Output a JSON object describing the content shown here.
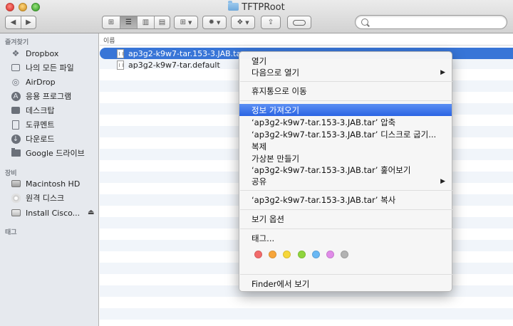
{
  "window": {
    "title": "TFTPRoot"
  },
  "sidebar": {
    "favorites_header": "즐겨찾기",
    "favorites": [
      {
        "label": "Dropbox",
        "icon": "dropbox-icon"
      },
      {
        "label": "나의 모든 파일",
        "icon": "all-files-icon"
      },
      {
        "label": "AirDrop",
        "icon": "airdrop-icon"
      },
      {
        "label": "응용 프로그램",
        "icon": "applications-icon"
      },
      {
        "label": "데스크탑",
        "icon": "desktop-icon"
      },
      {
        "label": "도큐멘트",
        "icon": "documents-icon"
      },
      {
        "label": "다운로드",
        "icon": "downloads-icon"
      },
      {
        "label": "Google 드라이브",
        "icon": "folder-icon"
      }
    ],
    "devices_header": "장비",
    "devices": [
      {
        "label": "Macintosh HD",
        "icon": "hard-disk-icon"
      },
      {
        "label": "원격 디스크",
        "icon": "remote-disc-icon"
      },
      {
        "label": "Install Cisco...",
        "icon": "disk-image-icon"
      }
    ],
    "tags_header": "태그"
  },
  "list": {
    "column_name": "이름",
    "files": [
      {
        "name": "ap3g2-k9w7-tar.153-3.JAB.tar",
        "selected": true
      },
      {
        "name": "ap3g2-k9w7-tar.default",
        "selected": false
      }
    ]
  },
  "context_menu": {
    "open": "열기",
    "open_with": "다음으로 열기",
    "move_to_trash": "휴지통으로 이동",
    "get_info": "정보 가져오기",
    "compress": "‘ap3g2-k9w7-tar.153-3.JAB.tar’ 압축",
    "burn": "‘ap3g2-k9w7-tar.153-3.JAB.tar’ 디스크로 굽기...",
    "duplicate": "복제",
    "make_alias": "가상본 만들기",
    "quick_look": "‘ap3g2-k9w7-tar.153-3.JAB.tar’ 훑어보기",
    "share": "공유",
    "copy": "‘ap3g2-k9w7-tar.153-3.JAB.tar’ 복사",
    "view_options": "보기 옵션",
    "tags": "태그...",
    "tag_colors": [
      "#f26b6b",
      "#f7a53a",
      "#f6d73a",
      "#8fd53d",
      "#6ab8f4",
      "#e18ce9",
      "#b3b3b3"
    ],
    "show_in_finder": "Finder에서 보기"
  }
}
